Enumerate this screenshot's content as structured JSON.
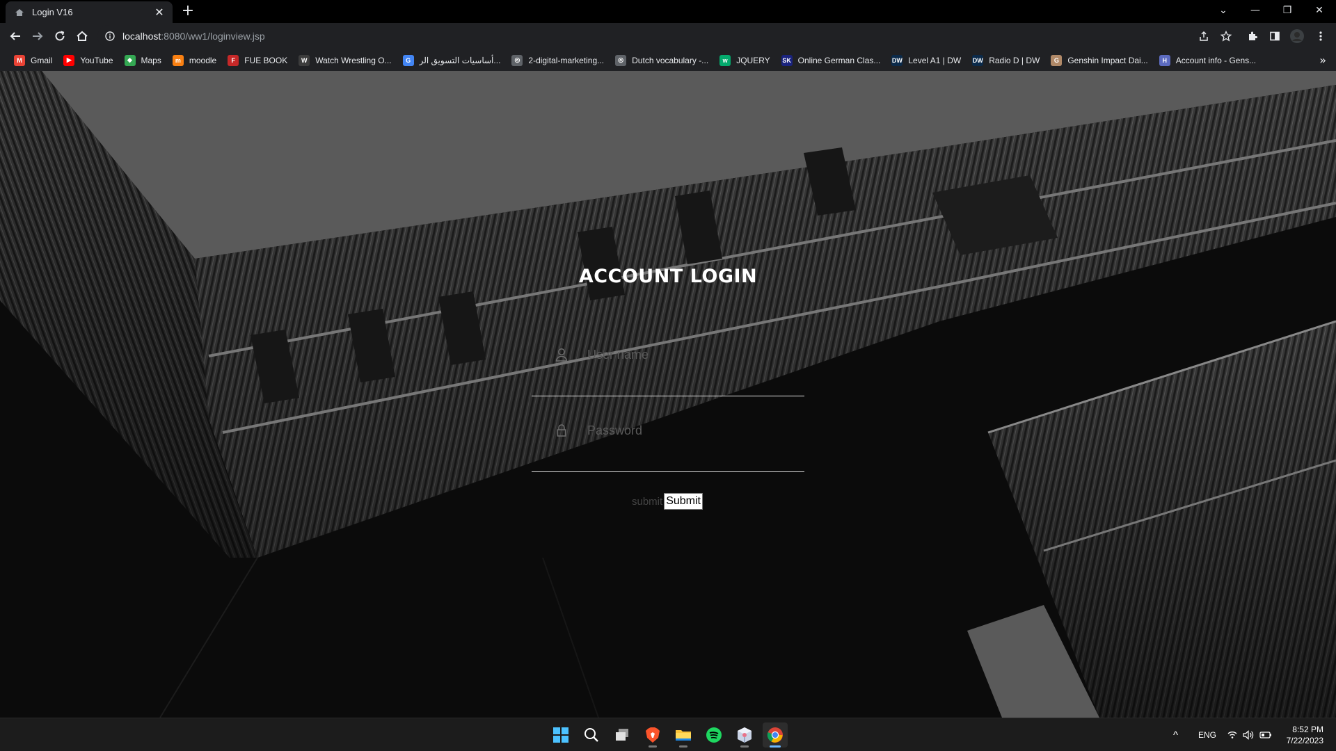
{
  "browser": {
    "tab": {
      "title": "Login V16",
      "close_glyph": "✕"
    },
    "new_tab_glyph": "+",
    "window_controls": {
      "tab_search": "⌄",
      "minimize": "—",
      "restore": "❐",
      "close": "✕"
    },
    "omnibox": {
      "host": "localhost",
      "rest": ":8080/ww1/loginview.jsp"
    },
    "bookmarks": [
      {
        "label": "Gmail",
        "icon": "gmail-icon",
        "color": "#ea4335",
        "glyph": "M"
      },
      {
        "label": "YouTube",
        "icon": "youtube-icon",
        "color": "#ff0000",
        "glyph": "▶"
      },
      {
        "label": "Maps",
        "icon": "maps-icon",
        "color": "#34a853",
        "glyph": "◆"
      },
      {
        "label": "moodle",
        "icon": "moodle-icon",
        "color": "#f98012",
        "glyph": "m"
      },
      {
        "label": "FUE BOOK",
        "icon": "fue-book-icon",
        "color": "#c62828",
        "glyph": "F"
      },
      {
        "label": "Watch Wrestling O...",
        "icon": "wordpress-icon",
        "color": "#3c3c3c",
        "glyph": "W"
      },
      {
        "label": "أساسيات التسويق الر...",
        "icon": "google-icon",
        "color": "#4285f4",
        "glyph": "G"
      },
      {
        "label": "2-digital-marketing...",
        "icon": "globe-icon",
        "color": "#5f6368",
        "glyph": "◎"
      },
      {
        "label": "Dutch vocabulary -...",
        "icon": "globe-icon",
        "color": "#5f6368",
        "glyph": "◎"
      },
      {
        "label": "JQUERY",
        "icon": "w3schools-icon",
        "color": "#04aa6d",
        "glyph": "w"
      },
      {
        "label": "Online German Clas...",
        "icon": "sk-icon",
        "color": "#1a237e",
        "glyph": "SK"
      },
      {
        "label": "Level A1 | DW",
        "icon": "dw-icon",
        "color": "#0b2a4a",
        "glyph": "DW"
      },
      {
        "label": "Radio D | DW",
        "icon": "dw-icon",
        "color": "#0b2a4a",
        "glyph": "DW"
      },
      {
        "label": "Genshin Impact Dai...",
        "icon": "genshin-icon",
        "color": "#b08968",
        "glyph": "G"
      },
      {
        "label": "Account info - Gens...",
        "icon": "hoyolab-icon",
        "color": "#5c6bc0",
        "glyph": "H"
      }
    ],
    "bookmarks_more": "»"
  },
  "login": {
    "title": "ACCOUNT LOGIN",
    "username_placeholder": "User name",
    "password_placeholder": "Password",
    "submit_label": "submit",
    "submit_button": "Submit"
  },
  "taskbar": {
    "apps": [
      {
        "name": "windows-start-icon"
      },
      {
        "name": "search-icon"
      },
      {
        "name": "task-view-icon"
      },
      {
        "name": "brave-icon"
      },
      {
        "name": "file-explorer-icon"
      },
      {
        "name": "spotify-icon"
      },
      {
        "name": "app-cube-icon"
      },
      {
        "name": "chrome-icon"
      }
    ],
    "tray": {
      "chevron": "^",
      "language": "ENG"
    },
    "clock": {
      "time": "8:52 PM",
      "date": "7/22/2023"
    }
  },
  "colors": {
    "accent": "#6cb8ff",
    "chrome_bg": "#202124",
    "page_bg": "#0b0b0b"
  }
}
